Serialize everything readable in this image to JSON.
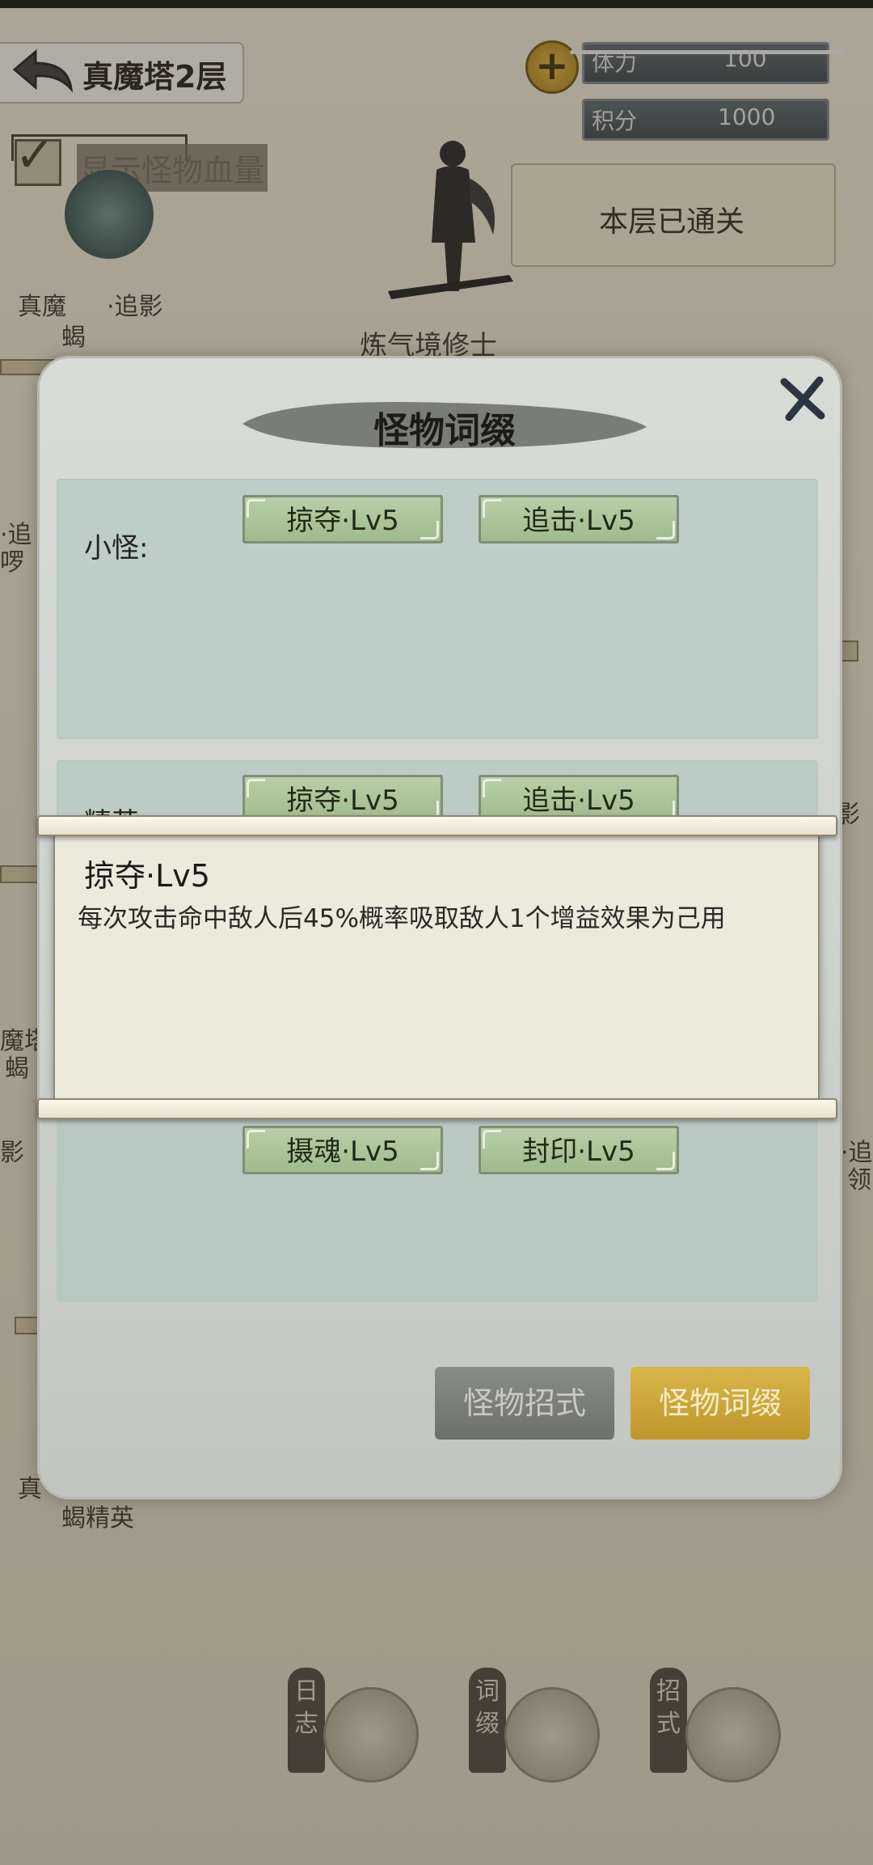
{
  "header": {
    "floor_title": "真魔塔2层",
    "stamina_label": "体力",
    "stamina_value": "100",
    "points_label": "积分",
    "points_value": "1000",
    "show_hp_label": "显示怪物血量",
    "cleared_label": "本层已通关",
    "hero_rank": "炼气境修士"
  },
  "background_monsters": {
    "top_left_name_a": "真魔",
    "top_left_name_b": "·追影",
    "top_left_sub": "蝎",
    "mid_left_a": "·追",
    "mid_left_b": "啰",
    "mid_right": "影",
    "left_lower_a": "魔塔",
    "left_lower_b": "蝎",
    "left_lower_c": "影",
    "right_lower_a": "·追",
    "right_lower_b": "领",
    "bottom_left_a": "真",
    "bottom_left_b": "蝎精英"
  },
  "dialog": {
    "title": "怪物词缀",
    "sections": [
      {
        "label": "小怪:",
        "tags": [
          "掠夺·Lv5",
          "追击·Lv5"
        ]
      },
      {
        "label": "精英",
        "tags": [
          "掠夺·Lv5",
          "追击·Lv5"
        ]
      },
      {
        "label": "",
        "tags": [
          "摄魂·Lv5",
          "封印·Lv5"
        ]
      }
    ],
    "btn_moves": "怪物招式",
    "btn_affix": "怪物词缀"
  },
  "tooltip": {
    "title": "掠夺·Lv5",
    "description": "每次攻击命中敌人后45%概率吸取敌人1个增益效果为己用"
  },
  "bottom_nav": [
    {
      "label": "日志",
      "icon": "book-icon"
    },
    {
      "label": "词缀",
      "icon": "swirl-icon"
    },
    {
      "label": "招式",
      "icon": "warrior-icon"
    }
  ],
  "colors": {
    "affix_button": "#d9b64a",
    "moves_button": "#7d807b",
    "tag_green": "#a9c494"
  }
}
